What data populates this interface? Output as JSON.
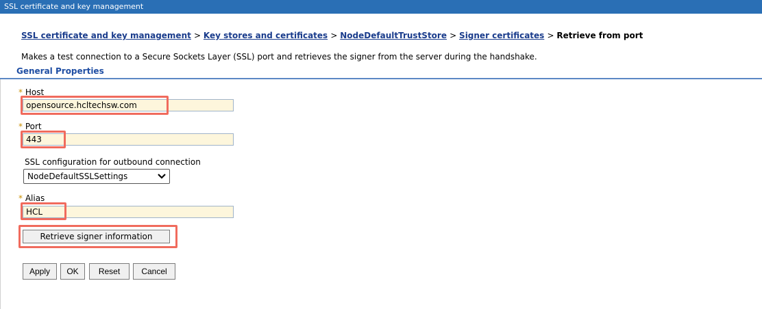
{
  "window": {
    "title": "SSL certificate and key management"
  },
  "breadcrumb": [
    {
      "label": "SSL certificate and key management"
    },
    {
      "label": "Key stores and certificates"
    },
    {
      "label": "NodeDefaultTrustStore"
    },
    {
      "label": "Signer certificates"
    }
  ],
  "breadcrumb_current": "Retrieve from port",
  "breadcrumb_separator": ">",
  "description": "Makes a test connection to a Secure Sockets Layer (SSL) port and retrieves the signer from the server during the handshake.",
  "section_title": "General Properties",
  "required_marker": "*",
  "form": {
    "host": {
      "label": "Host",
      "value": "opensource.hcltechsw.com"
    },
    "port": {
      "label": "Port",
      "value": "443"
    },
    "ssl_config": {
      "label": "SSL configuration for outbound connection",
      "selected": "NodeDefaultSSLSettings"
    },
    "alias": {
      "label": "Alias",
      "value": "HCL"
    },
    "retrieve_button": "Retrieve signer information"
  },
  "buttons": {
    "apply": "Apply",
    "ok": "OK",
    "reset": "Reset",
    "cancel": "Cancel"
  },
  "colors": {
    "titlebar": "#2a6fb5",
    "highlight": "#f06b5d",
    "field_bg": "#fdf6dc",
    "link": "#1a3c8c",
    "section": "#1f4ea3"
  }
}
